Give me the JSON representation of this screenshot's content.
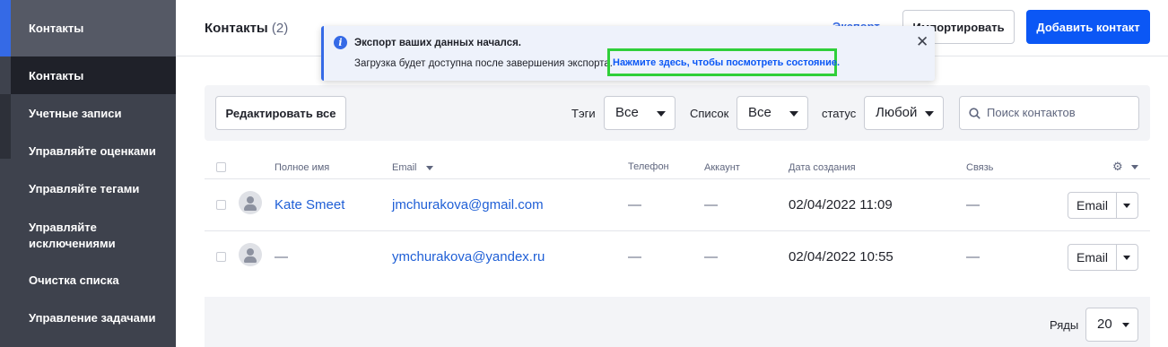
{
  "sidebar": {
    "header": "Контакты",
    "items": [
      {
        "label": "Контакты",
        "active": true
      },
      {
        "label": "Учетные записи"
      },
      {
        "label": "Управляйте оценками"
      },
      {
        "label": "Управляйте тегами"
      },
      {
        "label": "Управляйте исключениями"
      },
      {
        "label": "Очистка списка"
      },
      {
        "label": "Управление задачами"
      }
    ]
  },
  "header": {
    "title": "Контакты",
    "count": "(2)",
    "export_label": "Экспорт",
    "import_label": "Импортировать",
    "add_label": "Добавить контакт"
  },
  "toast": {
    "icon": "info-icon",
    "title": "Экспорт ваших данных начался.",
    "body": "Загрузка будет доступна после завершения экспорта.",
    "link": "Нажмите здесь, чтобы посмотреть состояние.",
    "close": "✕"
  },
  "filters": {
    "edit_all": "Редактировать все",
    "tags_label": "Тэги",
    "tags_value": "Все",
    "list_label": "Список",
    "list_value": "Все",
    "status_label": "статус",
    "status_value": "Любой",
    "search_placeholder": "Поиск контактов"
  },
  "table": {
    "columns": [
      "Полное имя",
      "Email",
      "Телефон",
      "Аккаунт",
      "Дата создания",
      "Связь"
    ],
    "rows": [
      {
        "name": "Kate Smeet",
        "email": "jmchurakova@gmail.com",
        "phone": "—",
        "account": "—",
        "created": "02/04/2022 11:09",
        "link": "—",
        "action": "Email"
      },
      {
        "name": "—",
        "email": "ymchurakova@yandex.ru",
        "phone": "—",
        "account": "—",
        "created": "02/04/2022 10:55",
        "link": "—",
        "action": "Email"
      }
    ]
  },
  "footer": {
    "rows_label": "Ряды",
    "rows_value": "20"
  },
  "colors": {
    "accent": "#356ae6",
    "primary_button": "#0b57f5",
    "sidebar_bg": "#3e424d",
    "highlight_border": "#2fcf3a"
  }
}
